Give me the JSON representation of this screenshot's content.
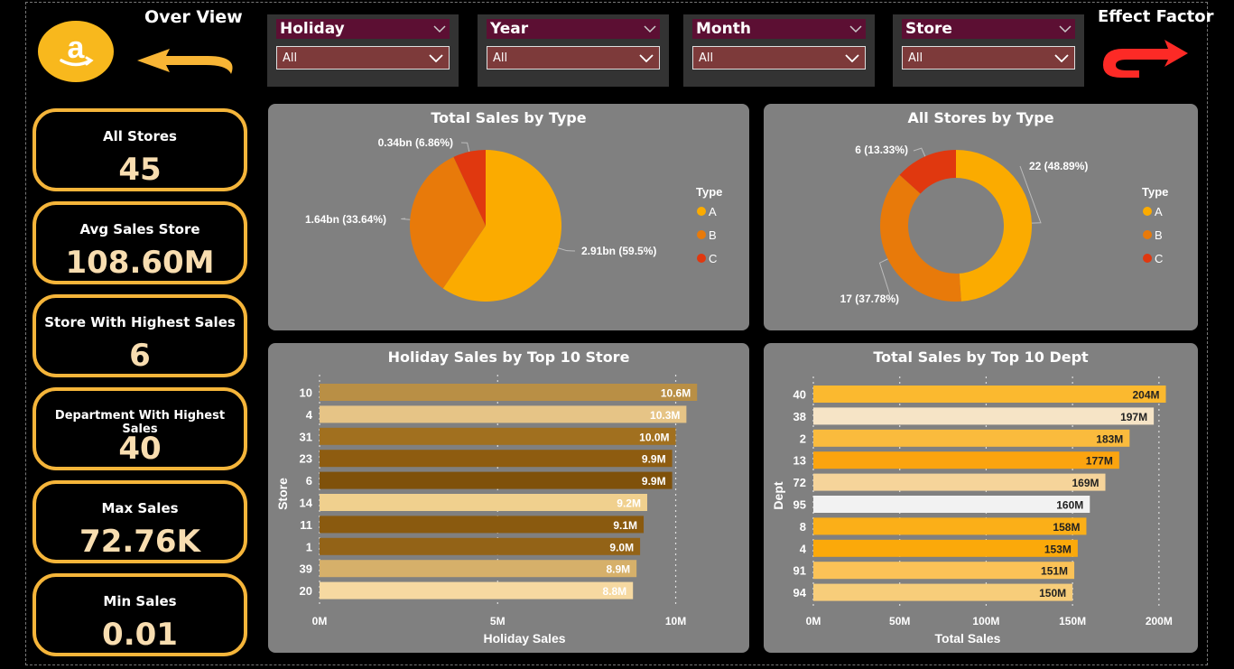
{
  "nav": {
    "overview_label": "Over View",
    "effect_label": "Effect Factor"
  },
  "slicers": [
    {
      "label": "Holiday",
      "value": "All"
    },
    {
      "label": "Year",
      "value": "All"
    },
    {
      "label": "Month",
      "value": "All"
    },
    {
      "label": "Store",
      "value": "All"
    }
  ],
  "kpis": [
    {
      "label": "All Stores",
      "value": "45"
    },
    {
      "label": "Avg Sales Store",
      "value": "108.60M"
    },
    {
      "label": "Store With Highest Sales",
      "value": "6"
    },
    {
      "label": "Department With Highest Sales",
      "value": "40"
    },
    {
      "label": "Max Sales",
      "value": "72.76K"
    },
    {
      "label": "Min Sales",
      "value": "0.01"
    }
  ],
  "colors": {
    "accent": "#f5b53a",
    "type_a": "#fbab00",
    "type_b": "#e87a0a",
    "type_c": "#e0380f",
    "slicer_head": "#5c0f33",
    "slicer_box": "#7d3a3a",
    "panel": "#808080"
  },
  "chart_data": [
    {
      "type": "pie",
      "title": "Total Sales by Type",
      "legend_title": "Type",
      "legend_position": "right",
      "categories": [
        "A",
        "B",
        "C"
      ],
      "values": [
        2.91,
        1.64,
        0.34
      ],
      "percent": [
        59.5,
        33.64,
        6.86
      ],
      "data_labels": [
        "2.91bn (59.5%)",
        "1.64bn (33.64%)",
        "0.34bn (6.86%)"
      ]
    },
    {
      "type": "pie",
      "donut": true,
      "title": "All Stores by Type",
      "legend_title": "Type",
      "legend_position": "right",
      "categories": [
        "A",
        "B",
        "C"
      ],
      "values": [
        22,
        17,
        6
      ],
      "percent": [
        48.89,
        37.78,
        13.33
      ],
      "data_labels": [
        "22 (48.89%)",
        "17 (37.78%)",
        "6 (13.33%)"
      ]
    },
    {
      "type": "bar",
      "orientation": "horizontal",
      "title": "Holiday Sales by Top 10 Store",
      "xlabel": "Holiday Sales",
      "ylabel": "Store",
      "categories": [
        "10",
        "4",
        "31",
        "23",
        "6",
        "14",
        "11",
        "1",
        "39",
        "20"
      ],
      "values": [
        10.6,
        10.3,
        10.0,
        9.9,
        9.9,
        9.2,
        9.1,
        9.0,
        8.9,
        8.8
      ],
      "data_labels": [
        "10.6M",
        "10.3M",
        "10.0M",
        "9.9M",
        "9.9M",
        "9.2M",
        "9.1M",
        "9.0M",
        "8.9M",
        "8.8M"
      ],
      "bar_colors": [
        "#b98f45",
        "#e6c486",
        "#a1701f",
        "#8e5c10",
        "#7f510a",
        "#f0d08e",
        "#8a5a0f",
        "#936317",
        "#d6b06a",
        "#f6d9a1"
      ],
      "xticks": [
        "0M",
        "5M",
        "10M"
      ],
      "xlim": [
        0,
        11
      ],
      "grid": true
    },
    {
      "type": "bar",
      "orientation": "horizontal",
      "title": "Total Sales by Top 10 Dept",
      "xlabel": "Total Sales",
      "ylabel": "Dept",
      "categories": [
        "40",
        "38",
        "2",
        "13",
        "72",
        "95",
        "8",
        "4",
        "91",
        "94"
      ],
      "values": [
        204,
        197,
        183,
        177,
        169,
        160,
        158,
        153,
        151,
        150
      ],
      "data_labels": [
        "204M",
        "197M",
        "183M",
        "177M",
        "169M",
        "160M",
        "158M",
        "153M",
        "151M",
        "150M"
      ],
      "bar_colors": [
        "#fbb92f",
        "#f6e4c6",
        "#fabb3d",
        "#fba40f",
        "#f6d49a",
        "#f2f2f2",
        "#fbaf18",
        "#fba90a",
        "#fbc257",
        "#f7cd7a"
      ],
      "xticks": [
        "0M",
        "50M",
        "100M",
        "150M",
        "200M"
      ],
      "xlim": [
        0,
        210
      ],
      "grid": true
    }
  ]
}
